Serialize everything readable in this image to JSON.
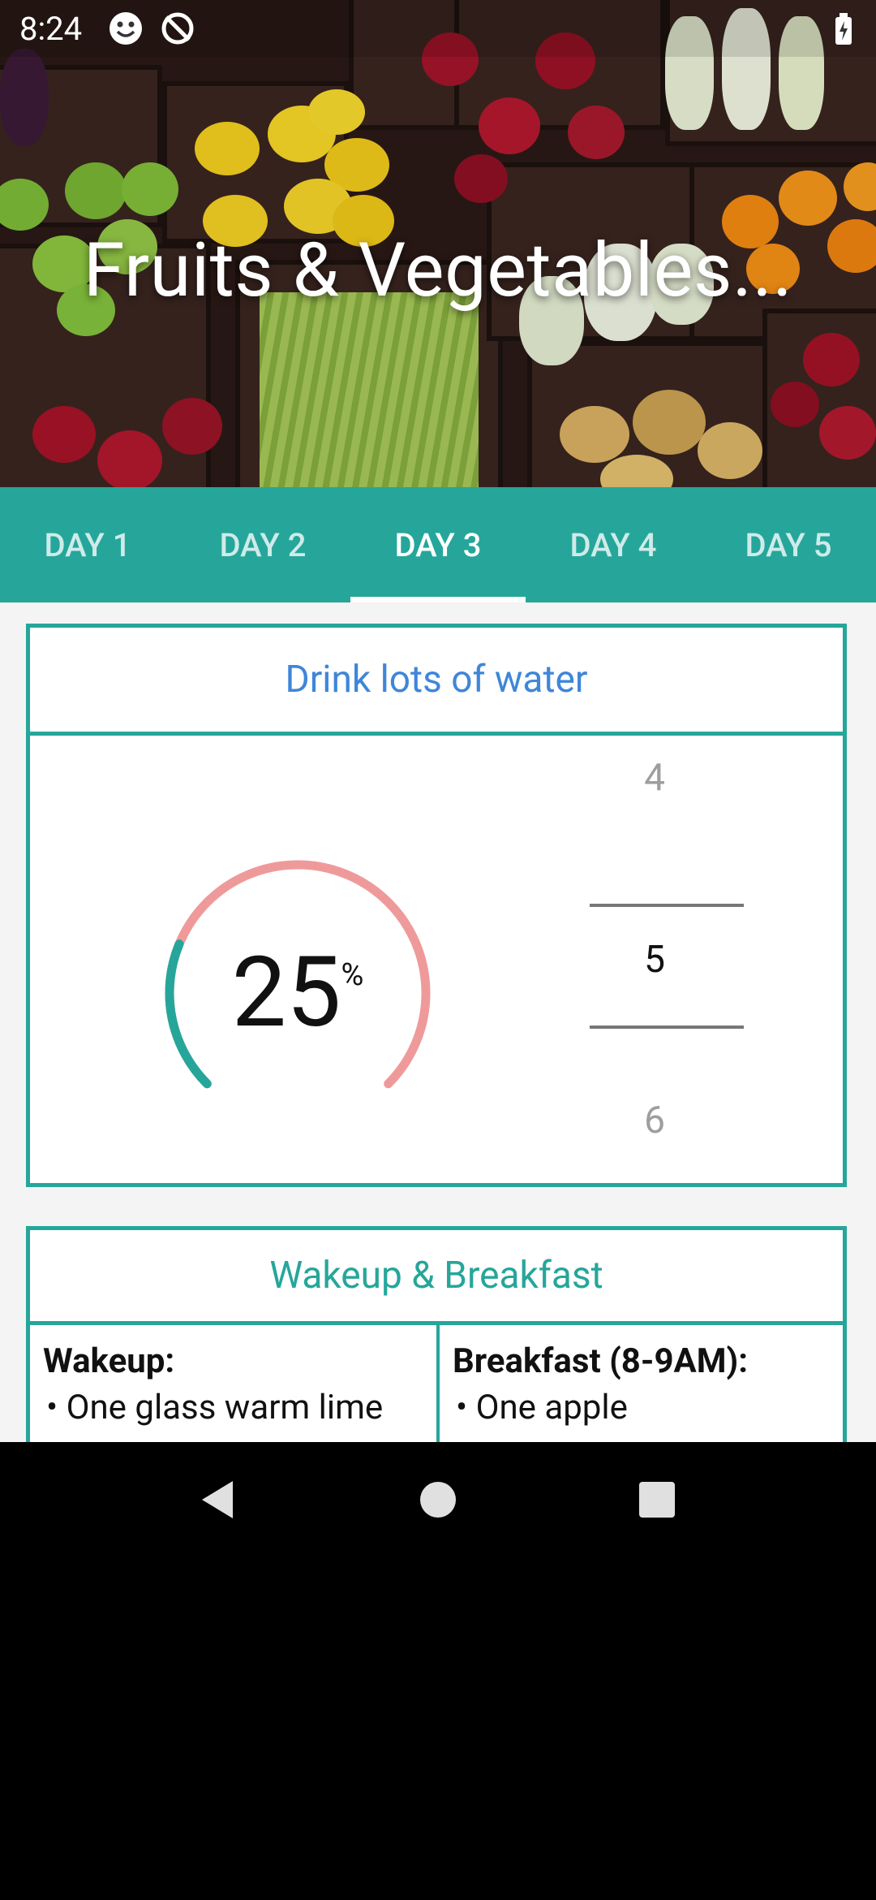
{
  "status_bar": {
    "time": "8:24",
    "icons": [
      "smiley-icon",
      "sync-off-icon",
      "battery-charging-icon"
    ]
  },
  "hero": {
    "title": "Fruits & Vegetables..."
  },
  "tabs": [
    {
      "label": "DAY 1",
      "active": false
    },
    {
      "label": "DAY 2",
      "active": false
    },
    {
      "label": "DAY 3",
      "active": true
    },
    {
      "label": "DAY 4",
      "active": false
    },
    {
      "label": "DAY 5",
      "active": false
    }
  ],
  "water_card": {
    "title": "Drink lots of water",
    "progress_value": "25",
    "progress_unit": "%",
    "progress_fraction": 0.25,
    "picker": {
      "prev": "4",
      "selected": "5",
      "next": "6"
    }
  },
  "meal_card": {
    "title": "Wakeup & Breakfast",
    "wakeup": {
      "title": "Wakeup:",
      "items": [
        "• One glass warm lime"
      ]
    },
    "breakfast": {
      "title": "Breakfast (8-9AM):",
      "items": [
        "• One apple"
      ]
    }
  },
  "colors": {
    "teal": "#26a69a",
    "blue_title": "#3f86d9",
    "progress_track": "#ef9a9a"
  },
  "nav_bar": {
    "icons": [
      "back-icon",
      "home-icon",
      "recents-icon"
    ]
  }
}
